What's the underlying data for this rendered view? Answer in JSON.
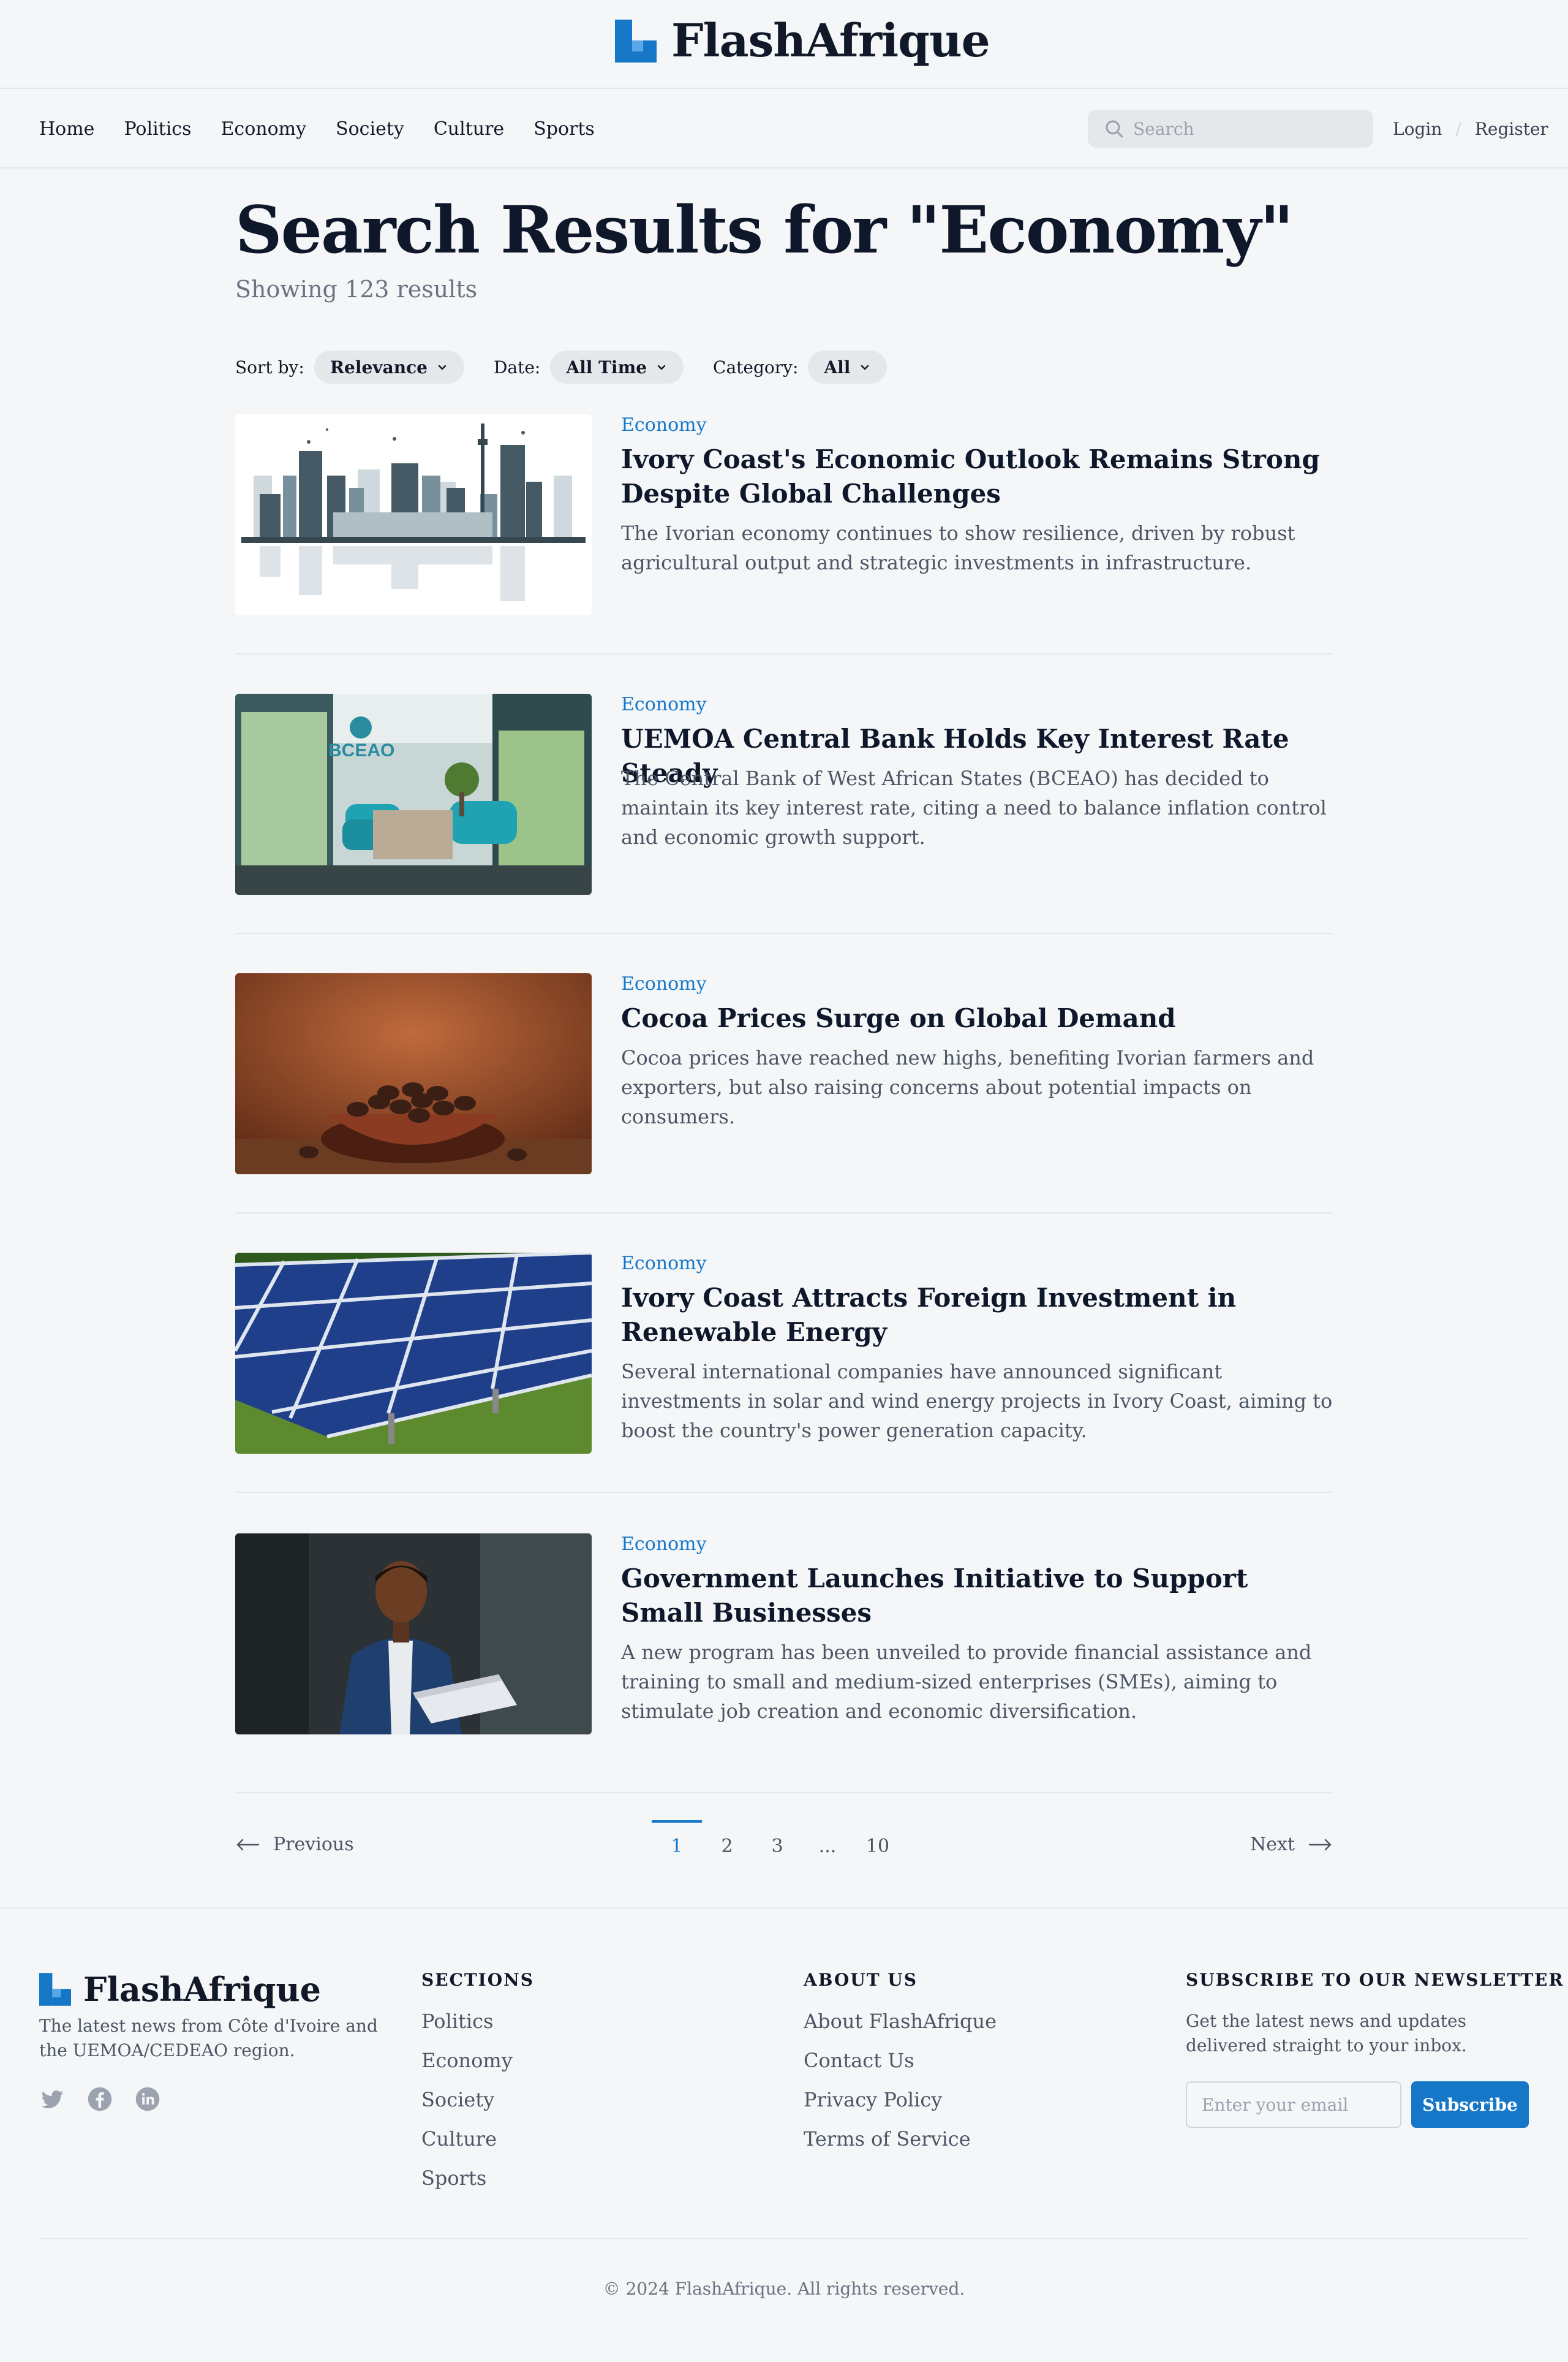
{
  "brand": {
    "name": "FlashAfrique",
    "accent": "#1677c9"
  },
  "nav": {
    "items": [
      "Home",
      "Politics",
      "Economy",
      "Society",
      "Culture",
      "Sports"
    ],
    "search_placeholder": "Search",
    "login": "Login",
    "register": "Register"
  },
  "main": {
    "title": "Search Results for \"Economy\"",
    "results_count": "Showing 123 results",
    "filters": {
      "sort_label": "Sort by:",
      "sort_value": "Relevance",
      "date_label": "Date:",
      "date_value": "All Time",
      "category_label": "Category:",
      "category_value": "All"
    },
    "articles": [
      {
        "category": "Economy",
        "title": "Ivory Coast's Economic Outlook Remains Strong Despite Global Challenges",
        "description": "The Ivorian economy continues to show resilience, driven by robust agricultural output and strategic investments in infrastructure.",
        "image": "city-skyline-illustration"
      },
      {
        "category": "Economy",
        "title": "UEMOA Central Bank Holds Key Interest Rate Steady",
        "description": "The Central Bank of West African States (BCEAO) has decided to maintain its key interest rate, citing a need to balance inflation control and economic growth support.",
        "image": "bceao-lobby-photo",
        "image_text": "BCEAO"
      },
      {
        "category": "Economy",
        "title": "Cocoa Prices Surge on Global Demand",
        "description": "Cocoa prices have reached new highs, benefiting Ivorian farmers and exporters, but also raising concerns about potential impacts on consumers.",
        "image": "cocoa-beans-bowl-photo"
      },
      {
        "category": "Economy",
        "title": "Ivory Coast Attracts Foreign Investment in Renewable Energy",
        "description": "Several international companies have announced significant investments in solar and wind energy projects in Ivory Coast, aiming to boost the country's power generation capacity.",
        "image": "solar-panels-photo"
      },
      {
        "category": "Economy",
        "title": "Government Launches Initiative to Support Small Businesses",
        "description": "A new program has been unveiled to provide financial assistance and training to small and medium-sized enterprises (SMEs), aiming to stimulate job creation and economic diversification.",
        "image": "businessman-laptop-photo"
      }
    ]
  },
  "pagination": {
    "previous": "Previous",
    "next": "Next",
    "pages": [
      "1",
      "2",
      "3",
      "...",
      "10"
    ],
    "current": "1"
  },
  "footer": {
    "brand": "FlashAfrique",
    "tagline": "The latest news from Côte d'Ivoire and the UEMOA/CEDEAO region.",
    "social_icons": [
      "twitter-icon",
      "facebook-icon",
      "linkedin-icon"
    ],
    "sections_title": "SECTIONS",
    "sections": [
      "Politics",
      "Economy",
      "Society",
      "Culture",
      "Sports"
    ],
    "about_title": "ABOUT US",
    "about": [
      "About FlashAfrique",
      "Contact Us",
      "Privacy Policy",
      "Terms of Service"
    ],
    "newsletter_title": "SUBSCRIBE TO OUR NEWSLETTER",
    "newsletter_desc": "Get the latest news and updates delivered straight to your inbox.",
    "newsletter_placeholder": "Enter your email",
    "subscribe": "Subscribe",
    "copyright": "© 2024 FlashAfrique. All rights reserved."
  }
}
